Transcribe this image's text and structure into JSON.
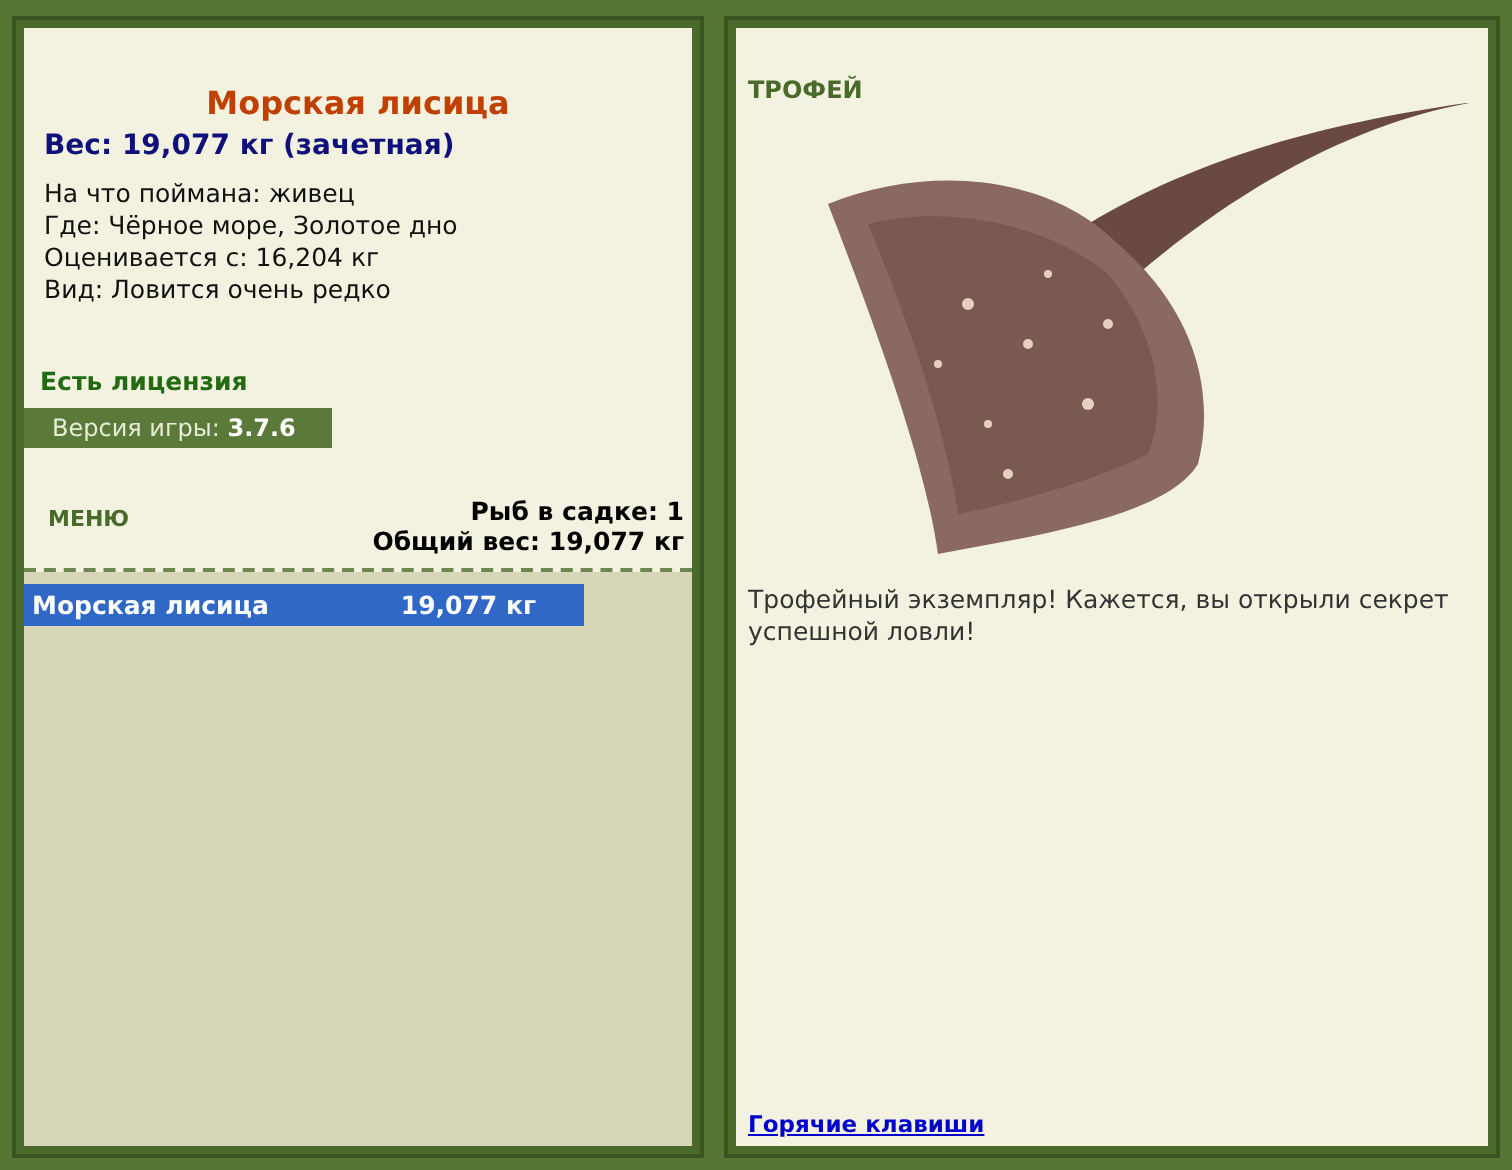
{
  "catch": {
    "name": "Морская лисица",
    "weight": "Вес: 19,077 кг (зачетная)",
    "details": [
      "На что поймана: живец",
      "Где: Чёрное море, Золотое дно",
      "Оценивается с: 16,204 кг",
      "Вид: Ловится очень редко"
    ]
  },
  "license": "Есть лицензия",
  "version": {
    "label": "Версия игры:",
    "value": "3.7.6"
  },
  "menu": "МЕНЮ",
  "keepnet": {
    "count": "Рыб в садке: 1",
    "total": "Общий вес: 19,077 кг"
  },
  "fish_list": [
    {
      "name": "Морская лисица",
      "weight": "19,077 кг",
      "selected": true
    }
  ],
  "trophy": {
    "heading": "ТРОФЕЙ",
    "message": "Трофейный экземпляр! Кажется, вы открыли секрет успешной ловли!"
  },
  "hotkeys_link": "Горячие клавиши"
}
